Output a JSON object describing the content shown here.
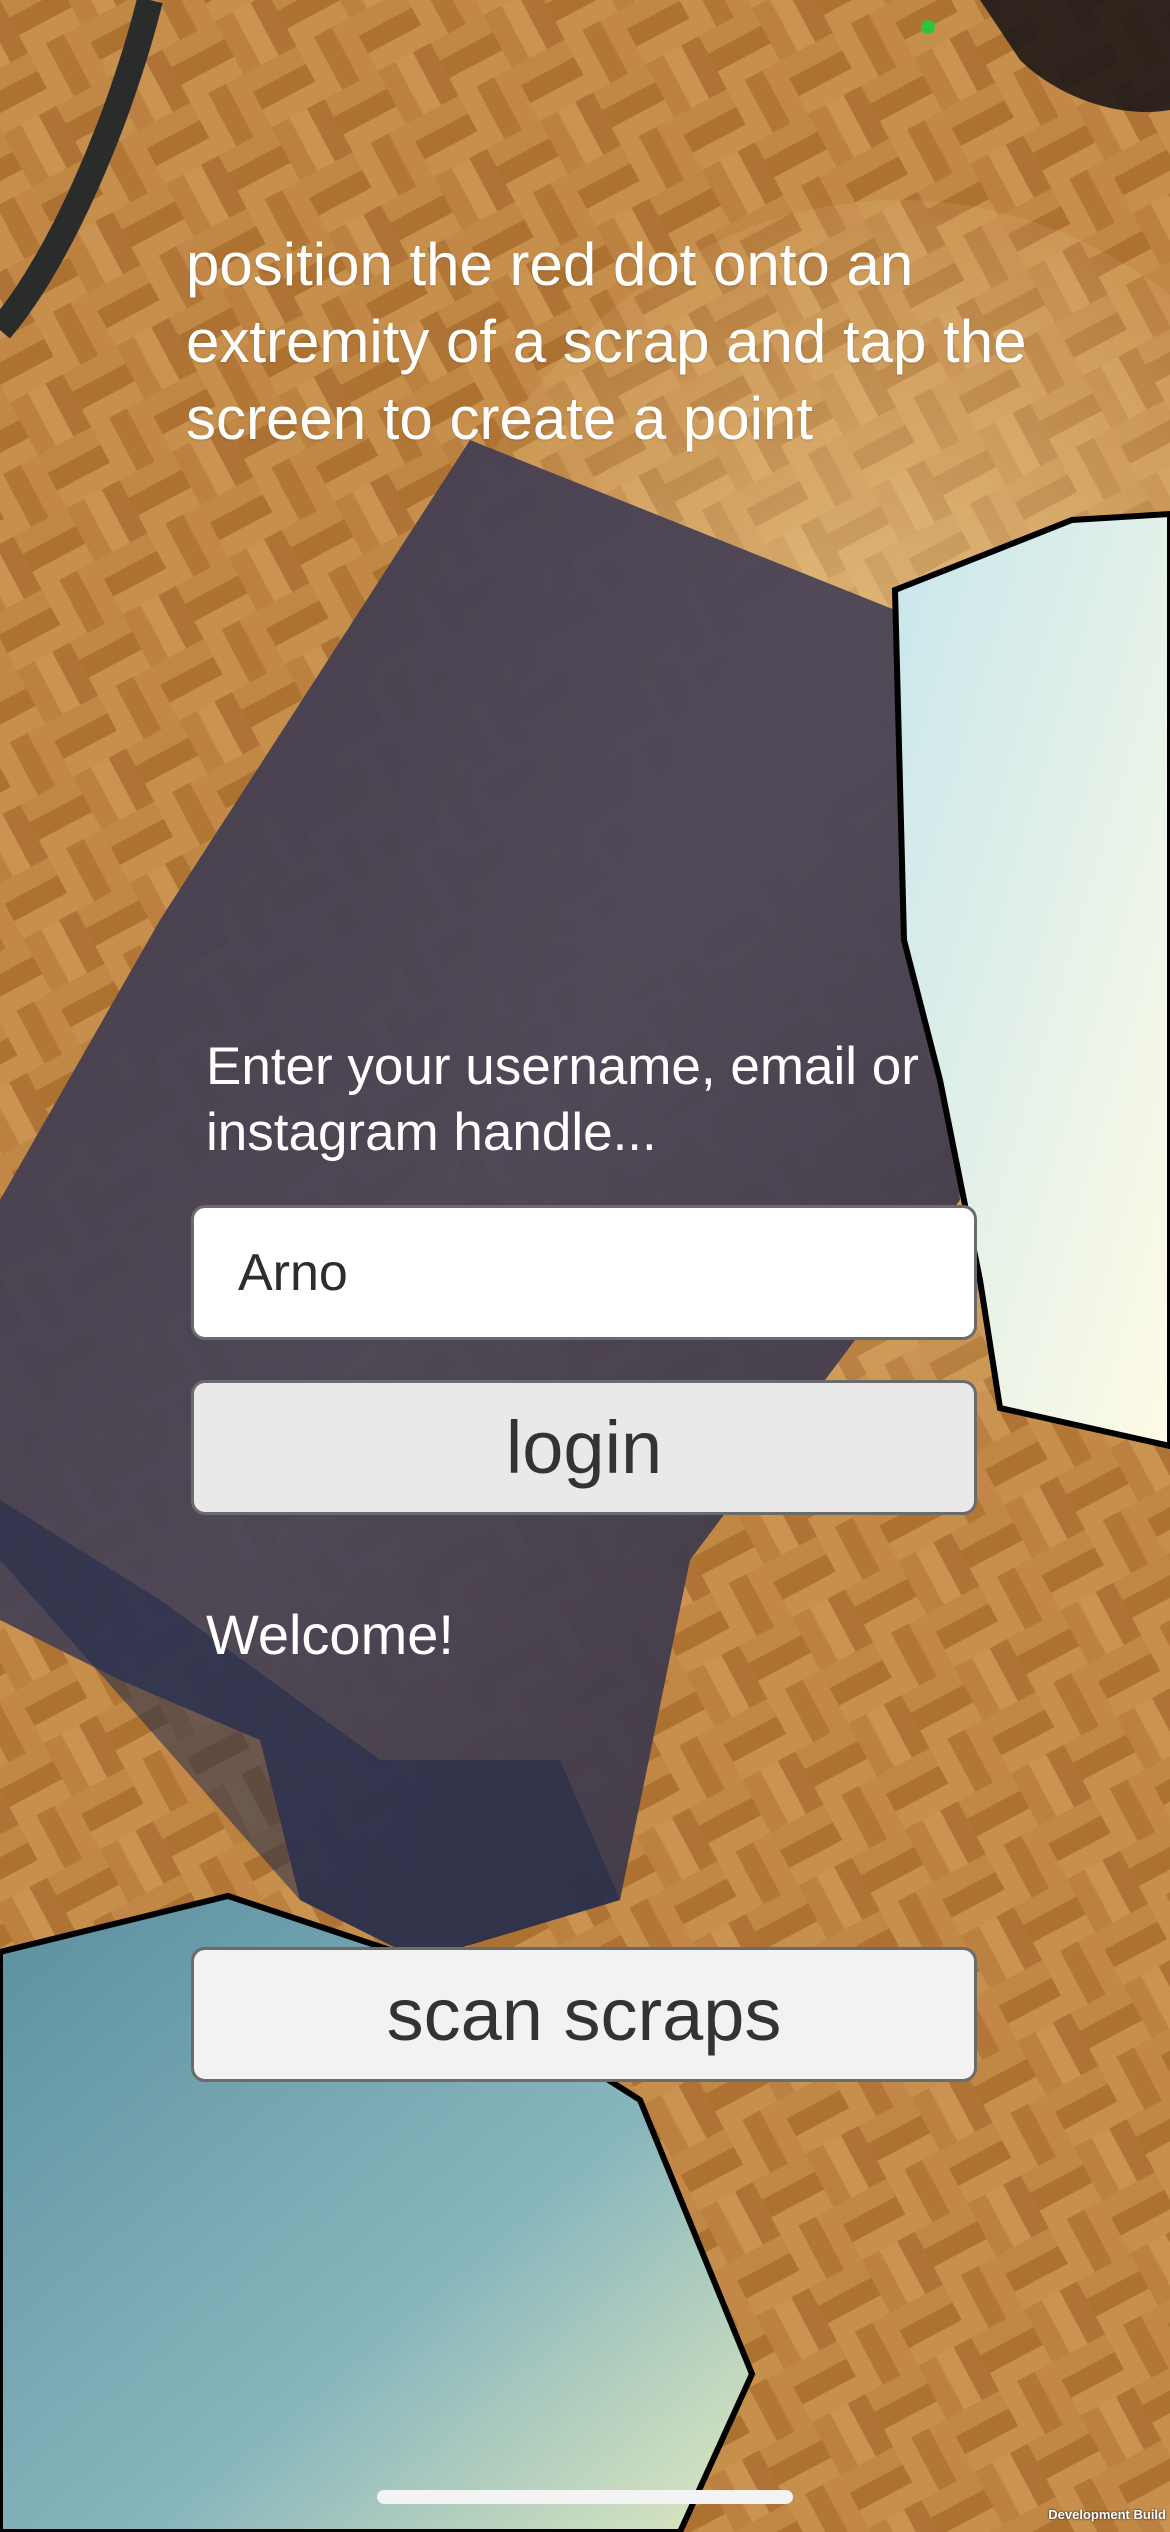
{
  "instructions": "position the red dot onto an extremity of a scrap and tap the screen to create a point",
  "login": {
    "prompt": "Enter your username, email or\ninstagram handle...",
    "username_value": "Arno",
    "button_label": "login"
  },
  "welcome_text": "Welcome!",
  "scan_button_label": "scan scraps",
  "dev_build_label": "Development Build",
  "colors": {
    "status_dot": "#2ec43a",
    "button_fill": "#e9e9e9",
    "button_border": "#6b6b6b",
    "scrap_fill": "#ecf8fa",
    "scrap_outline": "#000000"
  }
}
